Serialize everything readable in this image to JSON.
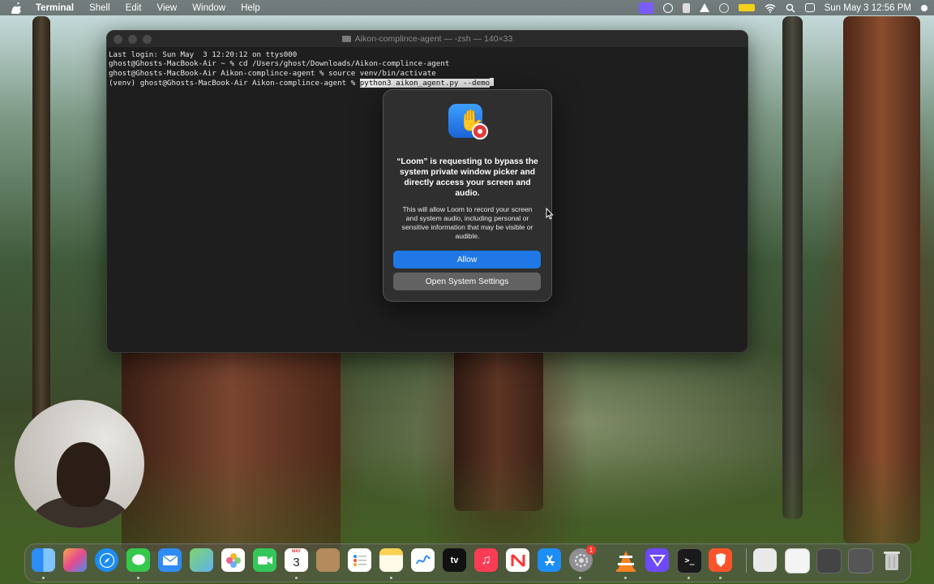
{
  "menubar": {
    "app_name": "Terminal",
    "items": [
      "Shell",
      "Edit",
      "View",
      "Window",
      "Help"
    ],
    "clock": "Sun May 3  12:56 PM"
  },
  "terminal": {
    "title": "Aikon-complince-agent — -zsh — 140×33",
    "lines": [
      "Last login: Sun May  3 12:20:12 on ttys000",
      "ghost@Ghosts-MacBook-Air ~ % cd /Users/ghost/Downloads/Aikon-complince-agent",
      "ghost@Ghosts-MacBook-Air Aikon-complince-agent % source venv/bin/activate"
    ],
    "prompt": "(venv) ghost@Ghosts-MacBook-Air Aikon-complince-agent % ",
    "command": "python3 aikon_agent.py --demo"
  },
  "dialog": {
    "title": "“Loom” is requesting to bypass the system private window picker and directly access your screen and audio.",
    "message": "This will allow Loom to record your screen and system audio, including personal or sensitive information that may be visible or audible.",
    "allow_label": "Allow",
    "settings_label": "Open System Settings"
  },
  "dock": {
    "calendar_month": "MAY",
    "calendar_day": "3",
    "settings_badge": "1",
    "items": [
      "finder",
      "launchpad",
      "safari",
      "messages",
      "mail",
      "maps",
      "photos",
      "facetime",
      "calendar",
      "contacts",
      "reminders",
      "notes",
      "freeform",
      "tv",
      "music",
      "news",
      "app-store",
      "system-settings",
      "vlc",
      "proton-vpn",
      "terminal",
      "brave",
      "preview",
      "document-1",
      "document-2",
      "window-1",
      "trash"
    ],
    "tv_label": "tv"
  }
}
